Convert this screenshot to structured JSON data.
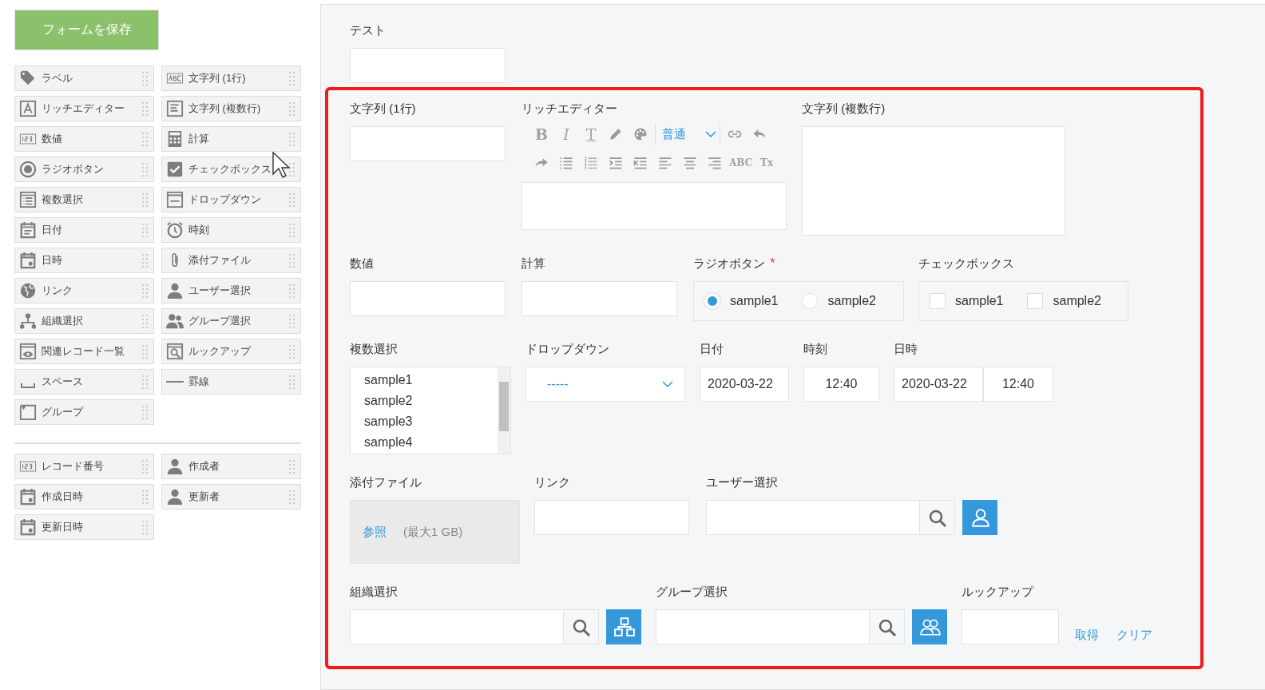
{
  "save_button": "フォームを保存",
  "palette": [
    {
      "label": "ラベル"
    },
    {
      "label": "文字列 (1行)"
    },
    {
      "label": "リッチエディター"
    },
    {
      "label": "文字列 (複数行)"
    },
    {
      "label": "数値"
    },
    {
      "label": "計算"
    },
    {
      "label": "ラジオボタン"
    },
    {
      "label": "チェックボックス"
    },
    {
      "label": "複数選択"
    },
    {
      "label": "ドロップダウン"
    },
    {
      "label": "日付"
    },
    {
      "label": "時刻"
    },
    {
      "label": "日時"
    },
    {
      "label": "添付ファイル"
    },
    {
      "label": "リンク"
    },
    {
      "label": "ユーザー選択"
    },
    {
      "label": "組織選択"
    },
    {
      "label": "グループ選択"
    },
    {
      "label": "関連レコード一覧"
    },
    {
      "label": "ルックアップ"
    },
    {
      "label": "スペース"
    },
    {
      "label": "罫線"
    },
    {
      "label": "グループ"
    }
  ],
  "palette_system": [
    {
      "label": "レコード番号"
    },
    {
      "label": "作成者"
    },
    {
      "label": "作成日時"
    },
    {
      "label": "更新者"
    },
    {
      "label": "更新日時"
    }
  ],
  "form": {
    "test": {
      "label": "テスト"
    },
    "text_single": {
      "label": "文字列 (1行)"
    },
    "rich_editor": {
      "label": "リッチエディター",
      "toolbar_rows": [
        [
          {
            "kind": "bold",
            "text": "B"
          },
          {
            "kind": "italic",
            "text": "I"
          },
          {
            "kind": "text-style",
            "text": "T"
          },
          {
            "kind": "pencil"
          },
          {
            "kind": "palette"
          },
          {
            "kind": "size",
            "text": "普通"
          },
          {
            "kind": "link"
          },
          {
            "kind": "undo"
          }
        ],
        [
          {
            "kind": "redo"
          },
          {
            "kind": "bullets"
          },
          {
            "kind": "numbers"
          },
          {
            "kind": "indent"
          },
          {
            "kind": "outdent"
          },
          {
            "kind": "align-left"
          },
          {
            "kind": "align-center"
          },
          {
            "kind": "align-right"
          },
          {
            "kind": "spell",
            "text": "ABC"
          },
          {
            "kind": "clear-format",
            "text": "Tx"
          }
        ]
      ]
    },
    "text_multi": {
      "label": "文字列 (複数行)"
    },
    "number": {
      "label": "数値"
    },
    "calc": {
      "label": "計算"
    },
    "radio": {
      "label": "ラジオボタン",
      "required_mark": "*",
      "options": [
        {
          "label": "sample1",
          "selected": true
        },
        {
          "label": "sample2",
          "selected": false
        }
      ]
    },
    "checkbox": {
      "label": "チェックボックス",
      "options": [
        {
          "label": "sample1",
          "checked": false
        },
        {
          "label": "sample2",
          "checked": false
        }
      ]
    },
    "multi_select": {
      "label": "複数選択",
      "options": [
        "sample1",
        "sample2",
        "sample3",
        "sample4"
      ]
    },
    "dropdown": {
      "label": "ドロップダウン",
      "value": "-----"
    },
    "date": {
      "label": "日付",
      "value": "2020-03-22"
    },
    "time": {
      "label": "時刻",
      "value": "12:40"
    },
    "datetime": {
      "label": "日時",
      "date": "2020-03-22",
      "time": "12:40"
    },
    "attachment": {
      "label": "添付ファイル",
      "browse": "参照",
      "limit": "(最大1 GB)"
    },
    "link": {
      "label": "リンク"
    },
    "user_select": {
      "label": "ユーザー選択"
    },
    "org_select": {
      "label": "組織選択"
    },
    "group_select": {
      "label": "グループ選択"
    },
    "lookup": {
      "label": "ルックアップ",
      "fetch": "取得",
      "clear": "クリア"
    }
  }
}
